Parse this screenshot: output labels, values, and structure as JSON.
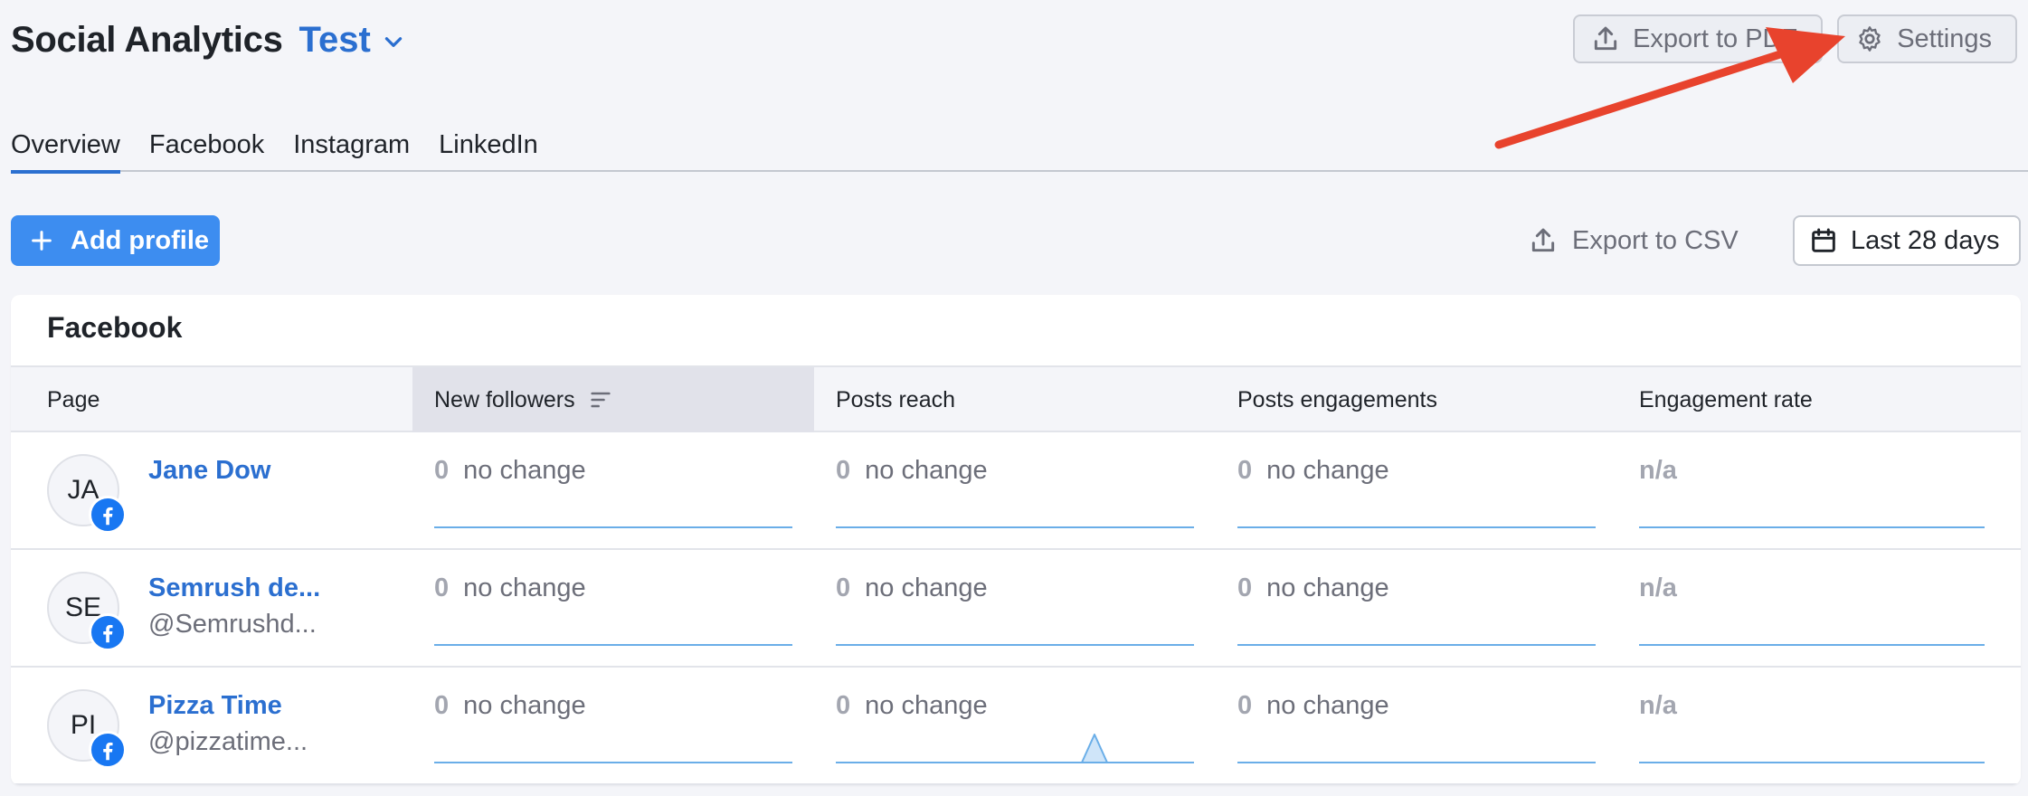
{
  "header": {
    "app_title": "Social Analytics",
    "project_name": "Test",
    "export_pdf_label": "Export to PDF",
    "settings_label": "Settings"
  },
  "tabs": [
    {
      "label": "Overview",
      "active": true
    },
    {
      "label": "Facebook",
      "active": false
    },
    {
      "label": "Instagram",
      "active": false
    },
    {
      "label": "LinkedIn",
      "active": false
    }
  ],
  "toolbar": {
    "add_profile_label": "Add profile",
    "export_csv_label": "Export to CSV",
    "date_range_label": "Last 28 days"
  },
  "card": {
    "title": "Facebook",
    "columns": [
      "Page",
      "New followers",
      "Posts reach",
      "Posts engagements",
      "Engagement rate"
    ],
    "rows": [
      {
        "initials": "JA",
        "name": "Jane Dow",
        "handle": "",
        "new_followers": {
          "value": "0",
          "change": "no change"
        },
        "posts_reach": {
          "value": "0",
          "change": "no change"
        },
        "posts_engagements": {
          "value": "0",
          "change": "no change"
        },
        "engagement_rate": "n/a"
      },
      {
        "initials": "SE",
        "name": "Semrush de...",
        "handle": "@Semrushd...",
        "new_followers": {
          "value": "0",
          "change": "no change"
        },
        "posts_reach": {
          "value": "0",
          "change": "no change"
        },
        "posts_engagements": {
          "value": "0",
          "change": "no change"
        },
        "engagement_rate": "n/a"
      },
      {
        "initials": "PI",
        "name": "Pizza Time",
        "handle": "@pizzatime...",
        "new_followers": {
          "value": "0",
          "change": "no change"
        },
        "posts_reach": {
          "value": "0",
          "change": "no change"
        },
        "posts_engagements": {
          "value": "0",
          "change": "no change"
        },
        "engagement_rate": "n/a"
      }
    ]
  },
  "colors": {
    "accent": "#2b6fd0",
    "primary_button": "#3d8df0",
    "facebook": "#1877f2",
    "annotation_arrow": "#e8432d",
    "sparkline": "#6aaee8"
  },
  "icons": {
    "project_dropdown": "chevron-down-icon",
    "export_pdf": "upload-icon",
    "settings": "gear-icon",
    "add_profile": "plus-icon",
    "export_csv": "upload-icon",
    "date_range": "calendar-icon",
    "sort": "sort-icon",
    "facebook": "facebook-icon"
  }
}
